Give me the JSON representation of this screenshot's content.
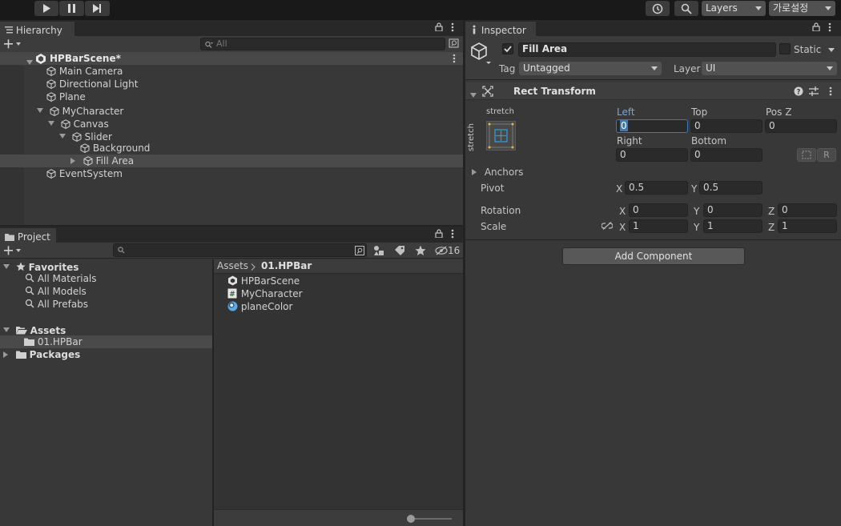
{
  "toolbar": {
    "layers_label": "Layers",
    "layout_label": "가로설정"
  },
  "hierarchy": {
    "tab_label": "Hierarchy",
    "search_placeholder": "All",
    "scene_name": "HPBarScene*",
    "items": [
      {
        "label": "Main Camera"
      },
      {
        "label": "Directional Light"
      },
      {
        "label": "Plane"
      },
      {
        "label": "MyCharacter"
      },
      {
        "label": "Canvas"
      },
      {
        "label": "Slider"
      },
      {
        "label": "Background"
      },
      {
        "label": "Fill Area"
      },
      {
        "label": "EventSystem"
      }
    ]
  },
  "project": {
    "tab_label": "Project",
    "search_placeholder": "",
    "hidden_count": "16",
    "favorites_label": "Favorites",
    "favorites": [
      "All Materials",
      "All Models",
      "All Prefabs"
    ],
    "assets_label": "Assets",
    "assets_children": [
      "01.HPBar"
    ],
    "packages_label": "Packages",
    "breadcrumb": {
      "root": "Assets",
      "current": "01.HPBar"
    },
    "files": [
      {
        "label": "HPBarScene",
        "icon": "scene-icon"
      },
      {
        "label": "MyCharacter",
        "icon": "script-icon"
      },
      {
        "label": "planeColor",
        "icon": "material-icon"
      }
    ]
  },
  "inspector": {
    "tab_label": "Inspector",
    "object_name": "Fill Area",
    "static_label": "Static",
    "tag_label": "Tag",
    "tag_value": "Untagged",
    "layer_label": "Layer",
    "layer_value": "UI",
    "component_title": "Rect Transform",
    "anchor_preset_h": "stretch",
    "anchor_preset_v": "stretch",
    "left_label": "Left",
    "left_value": "0",
    "top_label": "Top",
    "top_value": "0",
    "posz_label": "Pos Z",
    "posz_value": "0",
    "right_label": "Right",
    "right_value": "0",
    "bottom_label": "Bottom",
    "bottom_value": "0",
    "raw_button": "R",
    "anchors_label": "Anchors",
    "pivot_label": "Pivot",
    "pivot_x": "0.5",
    "pivot_y": "0.5",
    "rotation_label": "Rotation",
    "rotation": {
      "x": "0",
      "y": "0",
      "z": "0"
    },
    "scale_label": "Scale",
    "scale": {
      "x": "1",
      "y": "1",
      "z": "1"
    },
    "axis": {
      "x": "X",
      "y": "Y",
      "z": "Z"
    },
    "add_component_label": "Add Component"
  }
}
